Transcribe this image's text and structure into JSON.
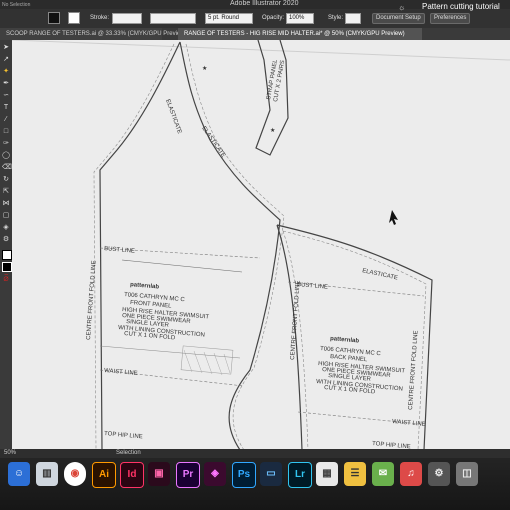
{
  "app": {
    "title": "Adobe Illustrator 2020",
    "selection": "No Selection"
  },
  "control_bar": {
    "stroke_label": "Stroke:",
    "stroke_profile": "5 pt. Round",
    "opacity_label": "Opacity:",
    "opacity_value": "100%",
    "style_label": "Style:",
    "doc_setup_label": "Document Setup",
    "preferences_label": "Preferences",
    "search_text": "Pattern cutting tutorial"
  },
  "tabs": [
    {
      "label": "SCOOP RANGE OF TESTERS.ai @ 33.33% (CMYK/GPU Preview)"
    },
    {
      "label": "RANGE OF TESTERS - HIG RISE MID HALTER.ai* @ 50% (CMYK/GPU Preview)"
    }
  ],
  "status": {
    "zoom": "50%",
    "tool": "Selection"
  },
  "front_panel": {
    "elastic_a": "ELASTICATE",
    "elastic_b": "ELASTICATE",
    "bust_line": "BUST LINE",
    "cf_line": "CENTRE FRONT FOLD LINE",
    "brand": "patternlab",
    "title": "T006 CATHRYN MC C",
    "subtitle": "FRONT PANEL",
    "detail_1": "HIGH RISE HALTER SWIMSUIT",
    "detail_2": "ONE PIECE SWIMWEAR",
    "detail_3": "SINGLE LAYER",
    "detail_4": "WITH LINING CONSTRUCTION",
    "cut": "CUT X 1 ON FOLD",
    "waist_line": "WAIST LINE",
    "hip_line": "TOP HIP LINE"
  },
  "back_panel": {
    "elastic": "ELASTICATE",
    "bust_line": "BUST LINE",
    "cb_line": "CENTRE FRONT FOLD LINE",
    "brand": "patternlab",
    "title": "T006 CATHRYN MC C",
    "subtitle": "BACK PANEL",
    "detail_1": "HIGH RISE HALTER SWIMSUIT",
    "detail_2": "ONE PIECE SWIMWEAR",
    "detail_3": "SINGLE LAYER",
    "detail_4": "WITH LINING CONSTRUCTION",
    "cut": "CUT X 1 ON FOLD",
    "waist_line": "WAIST LINE",
    "hip_line": "TOP HIP LINE"
  },
  "strap": {
    "line1": "STRAP PANEL",
    "line2": "CUT X 2 PAIRS"
  },
  "dock": [
    {
      "label": "Ai",
      "bg": "#2a1200",
      "fg": "#ff9a00"
    },
    {
      "label": "Id",
      "bg": "#2a0512",
      "fg": "#ff3366"
    },
    {
      "label": "Pr",
      "bg": "#1a0033",
      "fg": "#ea77ff"
    },
    {
      "label": "Ps",
      "bg": "#001d34",
      "fg": "#31a8ff"
    },
    {
      "label": "Lr",
      "bg": "#001a26",
      "fg": "#31c5f0"
    }
  ]
}
